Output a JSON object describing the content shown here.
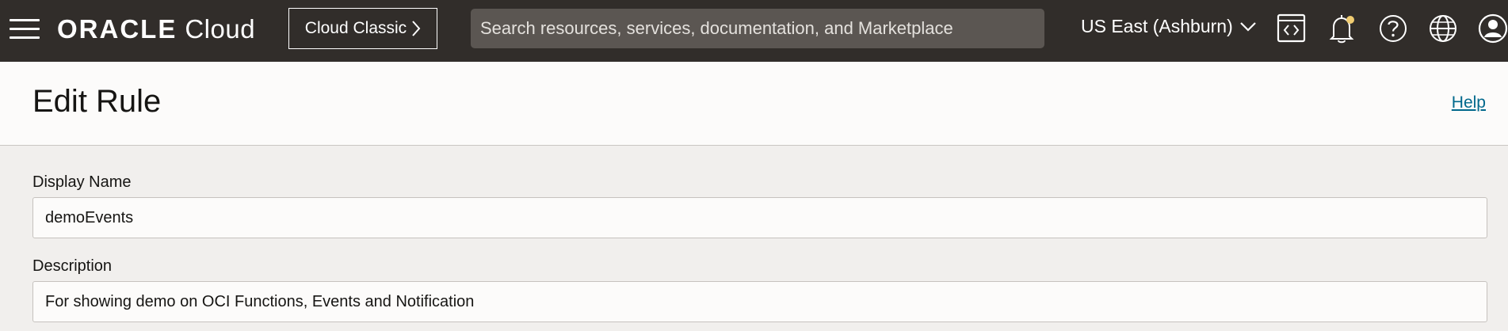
{
  "topbar": {
    "logo_brand": "ORACLE",
    "logo_product": "Cloud",
    "classic_label": "Cloud Classic",
    "search_placeholder": "Search resources, services, documentation, and Marketplace",
    "region_label": "US East (Ashburn)",
    "icons": [
      "menu-icon",
      "code-editor-icon",
      "bell-icon",
      "help-icon",
      "globe-icon",
      "user-icon"
    ],
    "notification_dot_color": "#f0cc71"
  },
  "header": {
    "title": "Edit Rule",
    "help_label": "Help"
  },
  "form": {
    "display_name_label": "Display Name",
    "display_name_value": "demoEvents",
    "description_label": "Description",
    "description_value": "For showing demo on OCI Functions, Events and Notification"
  }
}
